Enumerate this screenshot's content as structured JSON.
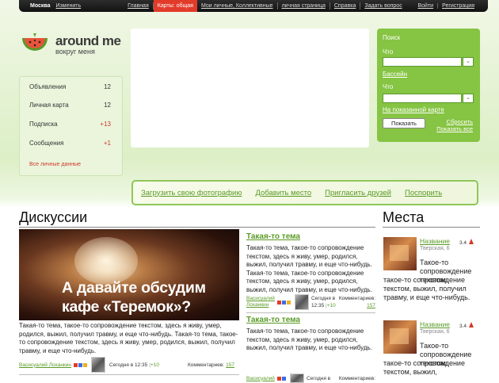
{
  "topbar": {
    "city": "Москва",
    "change": "Изменить",
    "nav": [
      "Главная",
      "Карты: общая",
      "Мои личные, Коллективные",
      "личная страница",
      "Справка",
      "Задать вопрос"
    ],
    "login": "Войти",
    "register": "Регистрация"
  },
  "logo": {
    "main": "around me",
    "sub": "вокруг меня"
  },
  "leftmenu": {
    "items": [
      {
        "label": "Объявления",
        "count": "12"
      },
      {
        "label": "Личная карта",
        "count": "12"
      },
      {
        "label": "Подписка",
        "count": "+13"
      },
      {
        "label": "Сообщения",
        "count": "+1"
      }
    ],
    "all_data": "Все личные данные"
  },
  "search": {
    "title": "Поиск",
    "what1": "Что",
    "link1": "Бассейн",
    "what2": "Что",
    "link2": "На показанной карте",
    "button": "Показать",
    "reset": "Сбросить",
    "show_all": "Показать все"
  },
  "actions": [
    "Загрузить свою фотографию",
    "Добавить место",
    "Пригласить друзей",
    "Поспорить"
  ],
  "discussions": {
    "heading": "Дискуссии",
    "featured": {
      "line1": "А давайте обсудим",
      "line2": "кафе «Теремок»?",
      "text": "Такая-то тема, такое-то сопровождение текстом, здесь я живу, умер, родился, выжил, получил травму, и еще что-нибудь. Такая-то тема, такое-то сопровождение текстом, здесь я живу, умер, родился, выжил, получил травму, и еще что-нибудь.",
      "user": "Васисуалий Лоханкин",
      "time": "Сегодня в 12:35",
      "plus": "+10",
      "comments_label": "Комментариев:",
      "comments": "157"
    },
    "topics": [
      {
        "title": "Такая-то тема",
        "text": "Такая-то тема, такое-то сопровождение текстом, здесь я живу, умер, родился, выжил, получил травму, и еще что-нибудь. Такая-то тема, такое-то сопровождение текстом, здесь я живу, умер, родился, выжил, получил травму, и еще что-нибудь.",
        "user": "Васисуалий Лоханкин",
        "time_a": "Сегодня в",
        "time_b": "12:35",
        "plus": "+10",
        "comments_label": "Комментариев:",
        "comments": "157"
      },
      {
        "title": "Такая-то тема",
        "text": "Такая-то тема, такое-то сопровождение текстом, здесь я живу, умер, родился, выжил, получил травму, и еще что-нибудь.",
        "user": "Васисуалий",
        "time_a": "Сегодня в",
        "comments_label": "Комментариев:"
      }
    ]
  },
  "places": {
    "heading": "Места",
    "items": [
      {
        "name": "Название",
        "street": "Тверская, 6",
        "rating": "3.4",
        "text_side": "Такое-то сопровождение текстом,",
        "text_below": "такое-то сопровождение текстом, выжил, получил травму, и еще что-нибудь."
      },
      {
        "name": "Название",
        "street": "Тверская, 6",
        "rating": "3.4",
        "text_side": "Такое-то сопровождение текстом,",
        "text_below": "такое-то сопровождение текстом, выжил,"
      }
    ]
  },
  "colors": {
    "accent": "#5a9a26",
    "search_bg": "#86c443",
    "active_tab": "#e23b2a"
  }
}
